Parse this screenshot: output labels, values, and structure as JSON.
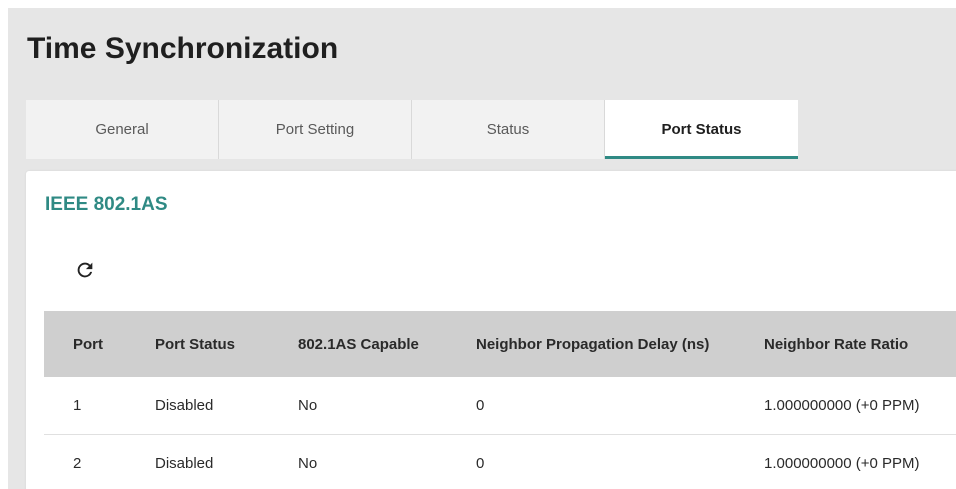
{
  "page": {
    "title": "Time Synchronization"
  },
  "tabs": [
    {
      "label": "General",
      "active": false
    },
    {
      "label": "Port Setting",
      "active": false
    },
    {
      "label": "Status",
      "active": false
    },
    {
      "label": "Port Status",
      "active": true
    }
  ],
  "section": {
    "title": "IEEE 802.1AS",
    "refresh_icon": "refresh-icon"
  },
  "table": {
    "columns": [
      "Port",
      "Port Status",
      "802.1AS Capable",
      "Neighbor Propagation Delay (ns)",
      "Neighbor Rate Ratio"
    ],
    "rows": [
      [
        "1",
        "Disabled",
        "No",
        "0",
        "1.000000000 (+0 PPM)"
      ],
      [
        "2",
        "Disabled",
        "No",
        "0",
        "1.000000000 (+0 PPM)"
      ]
    ]
  },
  "colors": {
    "accent": "#2f8a84",
    "background": "#e6e6e6",
    "header_bg": "#cfcfcf"
  }
}
